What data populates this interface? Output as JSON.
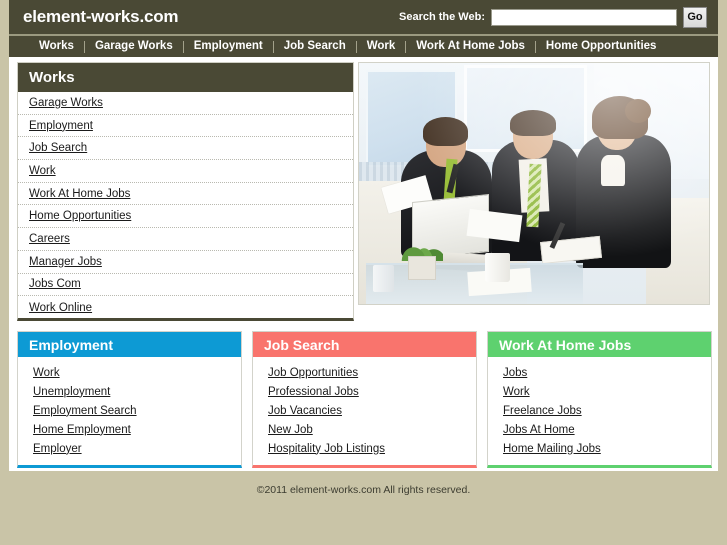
{
  "header": {
    "brand": "element-works.com",
    "search_label": "Search the Web:",
    "search_value": "",
    "search_placeholder": "",
    "go_label": "Go",
    "bar_color": "#4a4935"
  },
  "nav": {
    "items": [
      {
        "label": "Works"
      },
      {
        "label": "Garage Works"
      },
      {
        "label": "Employment"
      },
      {
        "label": "Job Search"
      },
      {
        "label": "Work"
      },
      {
        "label": "Work At Home Jobs"
      },
      {
        "label": "Home Opportunities"
      }
    ]
  },
  "sidebar": {
    "title": "Works",
    "header_color": "#4a4935",
    "items": [
      {
        "label": "Garage Works"
      },
      {
        "label": "Employment"
      },
      {
        "label": "Job Search"
      },
      {
        "label": "Work"
      },
      {
        "label": "Work At Home Jobs"
      },
      {
        "label": "Home Opportunities"
      },
      {
        "label": "Careers"
      },
      {
        "label": "Manager Jobs"
      },
      {
        "label": "Jobs Com"
      },
      {
        "label": "Work Online"
      }
    ]
  },
  "hero": {
    "alt": "three business people in dark suits reviewing documents around a laptop in a bright office"
  },
  "panels": [
    {
      "title": "Employment",
      "color": "#0d9ad4",
      "items": [
        {
          "label": "Work"
        },
        {
          "label": "Unemployment"
        },
        {
          "label": "Employment Search"
        },
        {
          "label": "Home Employment"
        },
        {
          "label": "Employer"
        }
      ]
    },
    {
      "title": "Job Search",
      "color": "#f9746d",
      "items": [
        {
          "label": "Job Opportunities"
        },
        {
          "label": "Professional Jobs"
        },
        {
          "label": "Job Vacancies"
        },
        {
          "label": "New Job"
        },
        {
          "label": "Hospitality Job Listings"
        }
      ]
    },
    {
      "title": "Work At Home Jobs",
      "color": "#5ed16f",
      "items": [
        {
          "label": "Jobs"
        },
        {
          "label": "Work"
        },
        {
          "label": "Freelance Jobs"
        },
        {
          "label": "Jobs At Home"
        },
        {
          "label": "Home Mailing Jobs"
        }
      ]
    }
  ],
  "footer": {
    "copyright": "©2011 element-works.com All rights reserved."
  },
  "theme": {
    "page_background": "#c9c4a7",
    "content_background": "#ffffff",
    "link_color": "#1b1b1b"
  }
}
